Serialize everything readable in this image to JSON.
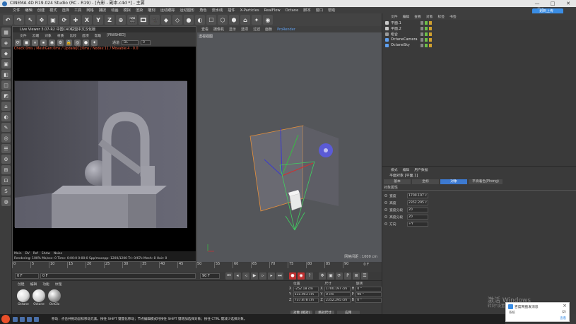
{
  "window": {
    "title": "CINEMA 4D R19.024 Studio (RC - R19) - [光影 - 副本.c4d *] - 主要",
    "controls": [
      "—",
      "□",
      "✕"
    ]
  },
  "menubar": [
    "文件",
    "编辑",
    "创建",
    "模式",
    "选择",
    "工具",
    "网格",
    "捕捉",
    "动画",
    "模拟",
    "渲染",
    "雕刻",
    "运动跟踪",
    "运动图形",
    "角色",
    "流水线",
    "插件",
    "X-Particles",
    "RealFlow",
    "Octane",
    "脚本",
    "窗口",
    "帮助"
  ],
  "interface_label": "界面",
  "cloud_button": "划到上传",
  "main_toolbar": [
    "↶",
    "↷",
    "↖",
    "✥",
    "▣",
    "⟳",
    "✚",
    "X",
    "Y",
    "Z",
    "⊕",
    "🎬",
    "🎞",
    "🎥",
    "◆",
    "◇",
    "●",
    "◐",
    "☐",
    "⬡",
    "⬢",
    "⌂",
    "✦",
    "◉"
  ],
  "left_tools": [
    "▦",
    "◈",
    "◆",
    "▣",
    "◧",
    "◫",
    "◩",
    "⌂",
    "◐",
    "✎",
    "◎",
    "☰",
    "⚙",
    "⊞",
    "⊡",
    "S",
    "◍"
  ],
  "live_viewer": {
    "title": "Live Viewer 3.07-R2 中国C4D联盟中文汉化版",
    "menu": [
      "文件",
      "云端",
      "对象",
      "材质",
      "比较",
      "选项",
      "帮助",
      "[FINISHED]"
    ],
    "tool_icons": [
      "⟳",
      "◼",
      "⏸",
      "⏹",
      "◉",
      "⚙",
      "🔒",
      "◎",
      "●",
      "✦"
    ],
    "channel": "DL",
    "channel_value": "0",
    "check_line": "Check:0ms / MeshGen:0ms / Update[C]:0ms / Nodes:11 / Movable:4 · 0.0",
    "status_tabs": [
      "Main",
      "DV",
      "Ref",
      "Shdw",
      "Noise"
    ],
    "status_line": "Rendering: 100%   Ms/sec: 0   Time: 0:00:0   0:00:0   Spp/maxspp: 1200/1200   Tri: 0/67k   Mesh: 8   Hair: 0"
  },
  "viewport": {
    "tabs": [
      {
        "label": "查看",
        "blue": false
      },
      {
        "label": "摄像机",
        "blue": false
      },
      {
        "label": "显示",
        "blue": false
      },
      {
        "label": "选项",
        "blue": false
      },
      {
        "label": "过滤",
        "blue": false
      },
      {
        "label": "面板",
        "blue": false
      },
      {
        "label": "ProRender",
        "blue": true
      }
    ],
    "view_label": "透视视图",
    "grid_spacing": "网格间距 : 1000 cm"
  },
  "timeline": {
    "ticks": [
      "0",
      "5",
      "10",
      "15",
      "20",
      "25",
      "30",
      "35",
      "40",
      "45",
      "50",
      "55",
      "60",
      "65",
      "70",
      "75",
      "80",
      "85",
      "90"
    ],
    "frame": "0 F",
    "start": "0 F",
    "current": "0 F",
    "end": "90 F",
    "end2": "90 F"
  },
  "material_manager": {
    "menu": [
      "创建",
      "编辑",
      "功能",
      "纹理"
    ],
    "materials": [
      {
        "name": "Octane",
        "color": "#d8d8d8"
      },
      {
        "name": "Octane",
        "color": "#cfcfcf"
      },
      {
        "name": "OctGlo",
        "color": "#9a9a9a"
      }
    ]
  },
  "coordinates": {
    "headers": [
      "位置",
      "尺寸",
      "旋转"
    ],
    "rows": [
      {
        "axis": "X",
        "pos": "-252.18 cm",
        "size": "1700.197 cm",
        "rot_axis": "H",
        "rot": "0 °"
      },
      {
        "axis": "Y",
        "pos": "531.943 cm",
        "size": "0 cm",
        "rot_axis": "P",
        "rot": "90 °"
      },
      {
        "axis": "Z",
        "pos": "737.878 cm",
        "size": "2352.295 cm",
        "rot_axis": "B",
        "rot": "0 °"
      }
    ],
    "mode1": "对象 (相对)",
    "mode2": "绝对尺寸",
    "apply": "应用"
  },
  "object_manager": {
    "menu": [
      "文件",
      "编辑",
      "查看",
      "对象",
      "标签",
      "书签"
    ],
    "objects": [
      {
        "name": "平面.1",
        "color": "#c9c9c9"
      },
      {
        "name": "平面.2",
        "color": "#c9c9c9"
      },
      {
        "name": "组合",
        "color": "#9a9a9a"
      },
      {
        "name": "OctaneCamera",
        "color": "#5fa0f0"
      },
      {
        "name": "OctaneSky",
        "color": "#5fa0f0"
      }
    ]
  },
  "attribute_manager": {
    "menu": [
      "模式",
      "编辑",
      "用户数据"
    ],
    "title": "平面对象 [平面.1]",
    "tabs": [
      {
        "label": "基本",
        "active": false
      },
      {
        "label": "坐标",
        "active": false
      },
      {
        "label": "对象",
        "active": true
      },
      {
        "label": "平滑着色(Phong)",
        "active": false
      }
    ],
    "section": "对象属性",
    "props": [
      {
        "key": "宽度",
        "value": "1700.197 c"
      },
      {
        "key": "高度",
        "value": "2352.295 c"
      },
      {
        "key": "宽度分段",
        "value": "20"
      },
      {
        "key": "高度分段",
        "value": "20"
      },
      {
        "key": "方向",
        "value": "+Y"
      }
    ]
  },
  "watermark": {
    "line1": "激活 Windows",
    "line2": "转到\"设置\"以激活 Windows。"
  },
  "notification": {
    "title": "百度网盘发消息",
    "sub": "系统",
    "count": "(2)",
    "link": "查看"
  },
  "taskbar": {
    "status": "移动：点击并拖动鼠标移动元素。按住 SHIFT 键量化移动；节点编辑模式时按住 SHIFT 键增加选择对象；按住 CTRL 键减少选择对象。"
  }
}
